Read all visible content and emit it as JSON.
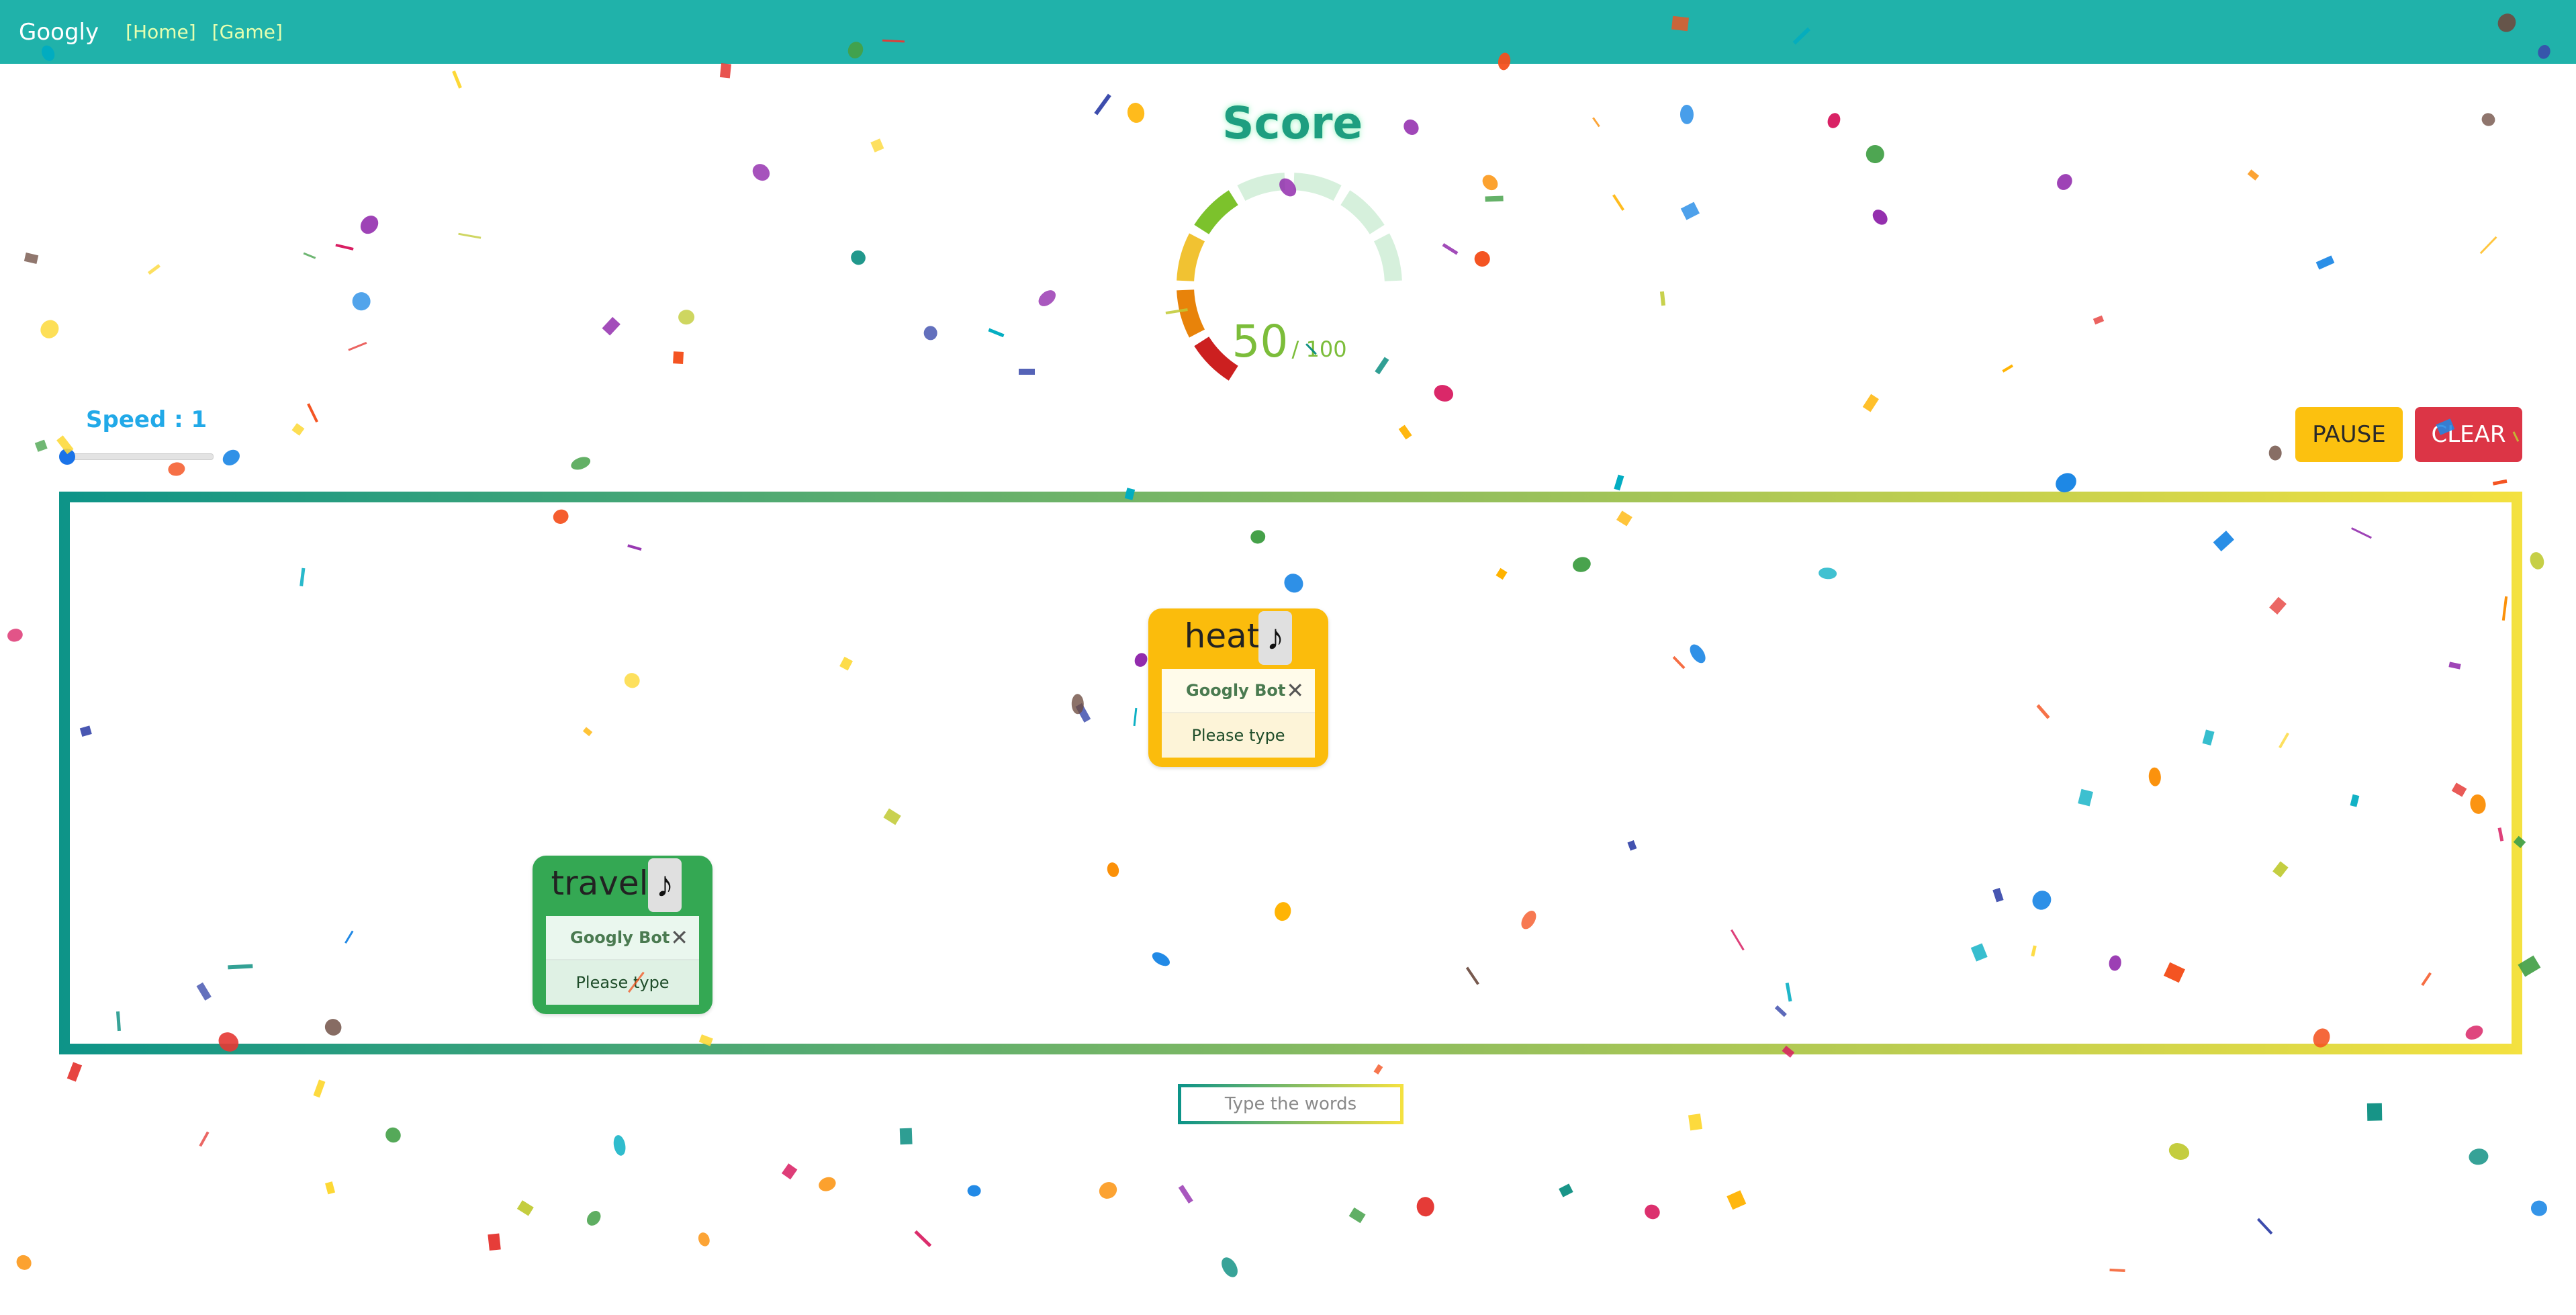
{
  "navbar": {
    "brand": "Googly",
    "links": [
      "[Home]",
      "[Game]"
    ],
    "background": "#20b2aa"
  },
  "score": {
    "title": "Score",
    "value": "50",
    "max": "/ 100",
    "fraction": 0.5,
    "segment_colors": [
      "#cc2020",
      "#e8830a",
      "#f1c232",
      "#7cc22c"
    ],
    "inactive_color": "#d6f0dc"
  },
  "speed": {
    "label": "Speed : 1",
    "value": 1
  },
  "buttons": {
    "pause": "PAUSE",
    "clear": "CLEAR"
  },
  "cards": [
    {
      "word": "heat",
      "sound_icon": "♪",
      "bot_name": "Googly Bot",
      "close_icon": "✕",
      "bot_message": "Please type",
      "color": "#fbbc0c"
    },
    {
      "word": "travel",
      "sound_icon": "♪",
      "bot_name": "Googly Bot",
      "close_icon": "✕",
      "bot_message": "Please type",
      "color": "#34a853"
    }
  ],
  "input": {
    "placeholder": "Type the words"
  },
  "colors": {
    "pause": "#fcc10f",
    "clear": "#dc3546",
    "frame_start": "#0d9488",
    "frame_end": "#f4e140"
  }
}
